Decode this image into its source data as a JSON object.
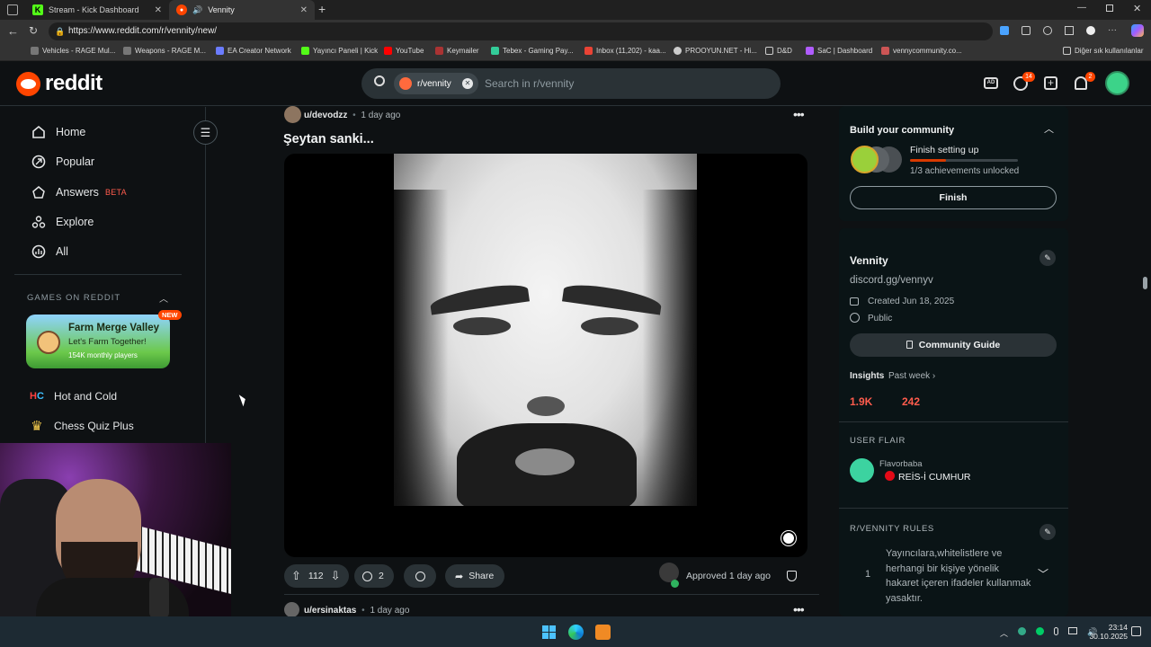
{
  "browser": {
    "tabs": [
      {
        "title": "Stream - Kick Dashboard",
        "active": false
      },
      {
        "title": "Vennity",
        "active": true
      }
    ],
    "url": "https://www.reddit.com/r/vennity/new/",
    "bookmarks": [
      "Vehicles - RAGE Mul...",
      "Weapons - RAGE M...",
      "EA Creator Network",
      "Yayıncı Paneli | Kick",
      "YouTube",
      "Keymailer",
      "Tebex - Gaming Pay...",
      "Inbox (11,202) - kaa...",
      "PROOYUN.NET - Hi...",
      "D&D",
      "SaC | Dashboard",
      "vennycommunity.co..."
    ],
    "other_bookmarks": "Diğer sık kullanılanlar"
  },
  "header": {
    "logo": "reddit",
    "search_chip": "r/vennity",
    "search_placeholder": "Search in r/vennity",
    "chat_badge": "14",
    "notif_badge": "2"
  },
  "sidebar": {
    "items": [
      {
        "label": "Home",
        "icon": "home-icon"
      },
      {
        "label": "Popular",
        "icon": "popular-icon"
      },
      {
        "label": "Answers",
        "badge": "BETA",
        "icon": "answers-icon"
      },
      {
        "label": "Explore",
        "icon": "explore-icon"
      },
      {
        "label": "All",
        "icon": "all-icon"
      }
    ],
    "games_heading": "GAMES ON REDDIT",
    "featured_game": {
      "title": "Farm Merge Valley",
      "subtitle": "Let's Farm Together!",
      "players": "154K monthly players",
      "badge": "NEW"
    },
    "games": [
      {
        "label": "Hot and Cold"
      },
      {
        "label": "Chess Quiz Plus"
      }
    ]
  },
  "post": {
    "author": "u/devodzz",
    "time": "1 day ago",
    "title": "Şeytan sanki...",
    "votes": "112",
    "comments": "2",
    "share_label": "Share",
    "approved": "Approved 1 day ago"
  },
  "next_post": {
    "author": "u/ersinaktas",
    "time": "1 day ago"
  },
  "right": {
    "build": {
      "title": "Build your community",
      "progress_title": "Finish setting up",
      "progress_sub": "1/3 achievements unlocked",
      "progress": 0.33,
      "button": "Finish"
    },
    "community": {
      "name": "Vennity",
      "link": "discord.gg/vennyv",
      "created": "Created Jun 18, 2025",
      "visibility": "Public",
      "guide_button": "Community Guide"
    },
    "insights": {
      "label": "Insights",
      "period": "Past week",
      "stat1": "1.9K",
      "stat2": "242"
    },
    "flair": {
      "heading": "USER FLAIR",
      "user": "Flavorbaba",
      "tag": "REİS-İ CUMHUR"
    },
    "rules": {
      "heading": "R/VENNITY RULES",
      "items": [
        {
          "num": "1",
          "text": "Yayıncılara,whitelistlere ve herhangi bir kişiye yönelik hakaret içeren ifadeler kullanmak yasaktır."
        }
      ]
    }
  },
  "taskbar": {
    "time": "23:14",
    "date": "30.10.2025"
  },
  "colors": {
    "accent": "#ff4500",
    "link_red": "#ff5c4d",
    "bg": "#0e1113"
  }
}
